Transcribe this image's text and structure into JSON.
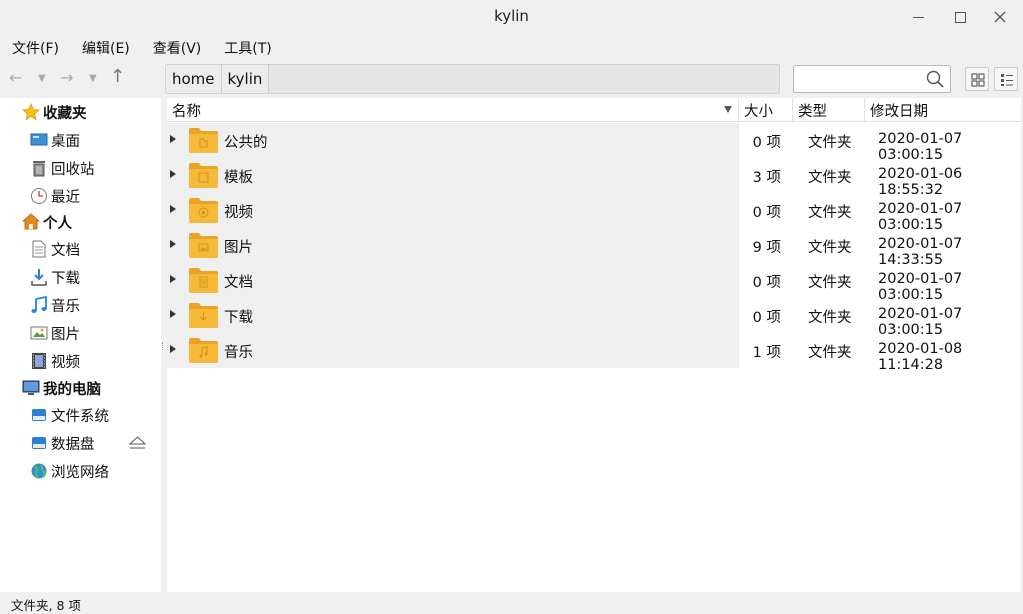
{
  "window": {
    "title": "kylin"
  },
  "menu": [
    "文件(F)",
    "编辑(E)",
    "查看(V)",
    "工具(T)"
  ],
  "path": [
    "home",
    "kylin"
  ],
  "search": {
    "placeholder": ""
  },
  "sidebar": {
    "groups": [
      {
        "label": "收藏夹",
        "icon": "star-icon",
        "items": [
          {
            "label": "桌面",
            "icon": "desktop-icon"
          },
          {
            "label": "回收站",
            "icon": "trash-icon"
          },
          {
            "label": "最近",
            "icon": "clock-icon"
          }
        ]
      },
      {
        "label": "个人",
        "icon": "home-icon",
        "items": [
          {
            "label": "文档",
            "icon": "document-icon"
          },
          {
            "label": "下载",
            "icon": "download-icon"
          },
          {
            "label": "音乐",
            "icon": "music-icon"
          },
          {
            "label": "图片",
            "icon": "picture-icon"
          },
          {
            "label": "视频",
            "icon": "video-icon"
          }
        ]
      },
      {
        "label": "我的电脑",
        "icon": "computer-icon",
        "items": [
          {
            "label": "文件系统",
            "icon": "drive-icon"
          },
          {
            "label": "数据盘",
            "icon": "drive-icon",
            "eject": true
          },
          {
            "label": "浏览网络",
            "icon": "globe-icon"
          }
        ]
      }
    ]
  },
  "columns": {
    "name": "名称",
    "size": "大小",
    "type": "类型",
    "date": "修改日期"
  },
  "files": [
    {
      "name": "公共的",
      "size": "0 项",
      "type": "文件夹",
      "date": "2020-01-07 03:00:15",
      "icon": "folder-share-icon"
    },
    {
      "name": "模板",
      "size": "3 项",
      "type": "文件夹",
      "date": "2020-01-06 18:55:32",
      "icon": "folder-template-icon"
    },
    {
      "name": "视频",
      "size": "0 项",
      "type": "文件夹",
      "date": "2020-01-07 03:00:15",
      "icon": "folder-video-icon"
    },
    {
      "name": "图片",
      "size": "9 项",
      "type": "文件夹",
      "date": "2020-01-07 14:33:55",
      "icon": "folder-picture-icon"
    },
    {
      "name": "文档",
      "size": "0 项",
      "type": "文件夹",
      "date": "2020-01-07 03:00:15",
      "icon": "folder-document-icon"
    },
    {
      "name": "下载",
      "size": "0 项",
      "type": "文件夹",
      "date": "2020-01-07 03:00:15",
      "icon": "folder-download-icon"
    },
    {
      "name": "音乐",
      "size": "1 项",
      "type": "文件夹",
      "date": "2020-01-08 11:14:28",
      "icon": "folder-music-icon"
    }
  ],
  "status": "文件夹, 8 项",
  "colors": {
    "folder": "#f5b93a",
    "folder_dark": "#e9a424",
    "row_bg": "#efefef"
  }
}
